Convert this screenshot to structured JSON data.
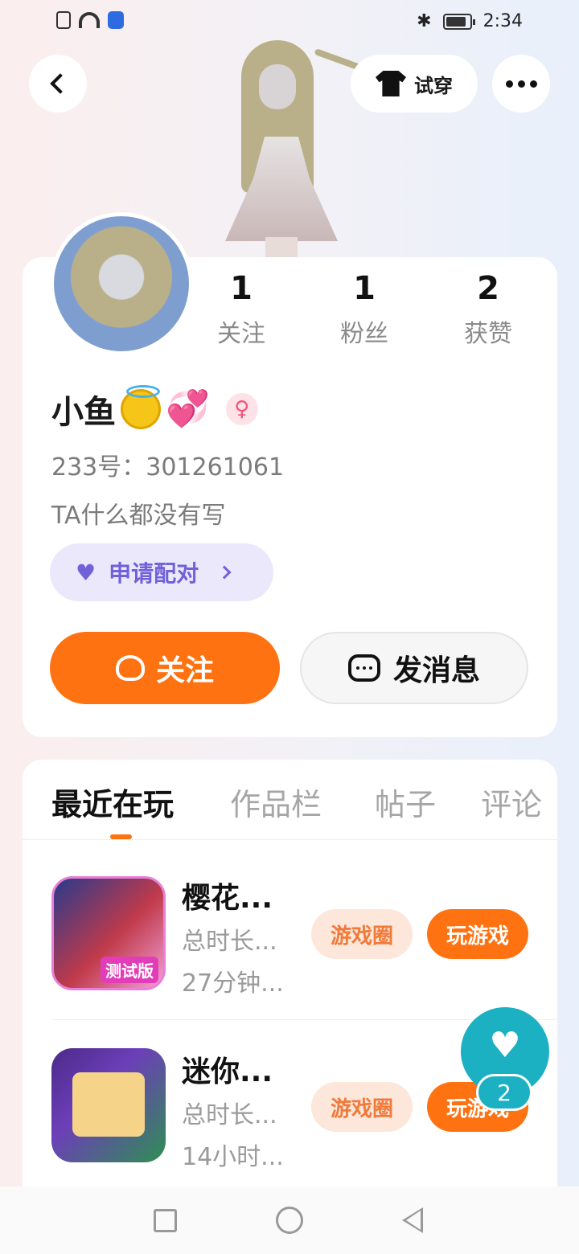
{
  "status_bar": {
    "time": "2:34",
    "bluetooth": "✱"
  },
  "header": {
    "back_icon": "chevron-left-icon",
    "try_on_label": "试穿",
    "more_icon": "more-dots-icon"
  },
  "profile": {
    "stats": [
      {
        "value": "1",
        "label": "关注"
      },
      {
        "value": "1",
        "label": "粉丝"
      },
      {
        "value": "2",
        "label": "获赞"
      }
    ],
    "name": "小鱼",
    "emoji_heart": "💞",
    "gender_symbol": "♀",
    "uid": "233号：301261061",
    "bio": "TA什么都没有写",
    "pair_label": "申请配对",
    "follow_label": "关注",
    "message_label": "发消息"
  },
  "tabs": [
    {
      "label": "最近在玩",
      "active": true
    },
    {
      "label": "作品栏",
      "active": false
    },
    {
      "label": "帖子",
      "active": false
    },
    {
      "label": "评论",
      "active": false
    }
  ],
  "games": [
    {
      "title": "樱花...",
      "total_label": "总时长...",
      "duration": "27分钟...",
      "badge": "测试版",
      "circle_label": "游戏圈",
      "play_label": "玩游戏"
    },
    {
      "title": "迷你...",
      "total_label": "总时长...",
      "duration": "14小时...",
      "circle_label": "游戏圈",
      "play_label": "玩游戏"
    }
  ],
  "float_button": {
    "count": "2",
    "icon": "heart-icon"
  },
  "colors": {
    "accent": "#ff7211",
    "pair": "#7161d9",
    "float": "#1bb0c2"
  }
}
